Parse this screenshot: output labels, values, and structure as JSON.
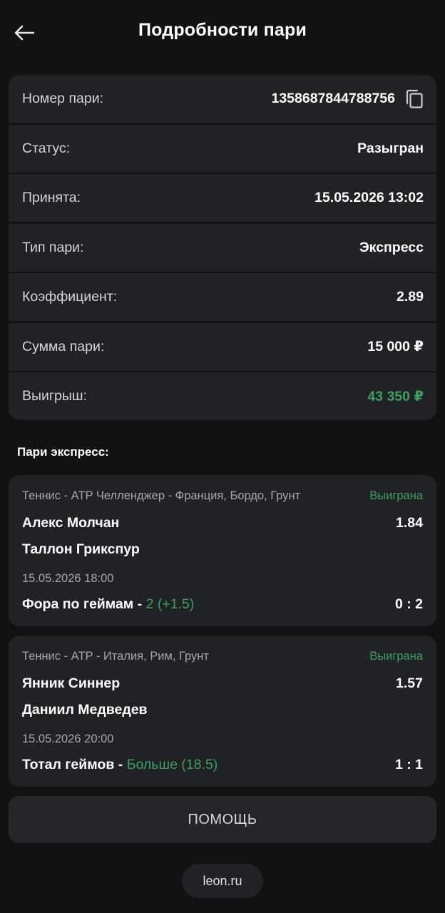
{
  "header": {
    "title": "Подробности пари",
    "back_icon": "arrow-left-icon"
  },
  "details": [
    {
      "label": "Номер пари:",
      "value": "1358687844788756",
      "icon": "copy-icon"
    },
    {
      "label": "Статус:",
      "value": "Разыгран"
    },
    {
      "label": "Принята:",
      "value": "15.05.2026 13:02"
    },
    {
      "label": "Тип пари:",
      "value": "Экспресс"
    },
    {
      "label": "Коэффициент:",
      "value": "2.89"
    },
    {
      "label": "Сумма пари:",
      "value": "15 000 ₽"
    },
    {
      "label": "Выигрыш:",
      "value": "43 350 ₽",
      "color": "#3da05f"
    }
  ],
  "section_title": "Пари экспресс:",
  "bets": [
    {
      "league": "Теннис - ATP Челленджер - Франция, Бордо, Грунт",
      "status": "Выиграна",
      "team1": "Алекс Молчан",
      "odds": "1.84",
      "team2": "Таллон Грикспур",
      "date": "15.05.2026 18:00",
      "market": "Фора по геймам",
      "separator": " - ",
      "outcome": "2 (+1.5)",
      "score": "0 : 2"
    },
    {
      "league": "Теннис - ATP - Италия, Рим, Грунт",
      "status": "Выиграна",
      "team1": "Янник Синнер",
      "odds": "1.57",
      "team2": "Даниил Медведев",
      "date": "15.05.2026 20:00",
      "market": "Тотал геймов",
      "separator": " - ",
      "outcome": "Больше (18.5)",
      "score": "1 : 1"
    }
  ],
  "help_button": "ПОМОЩЬ",
  "domain": "leon.ru",
  "colors": {
    "background": "#111214",
    "card": "#202226",
    "accent_green": "#3da05f",
    "muted_text": "#a4a7ae"
  }
}
